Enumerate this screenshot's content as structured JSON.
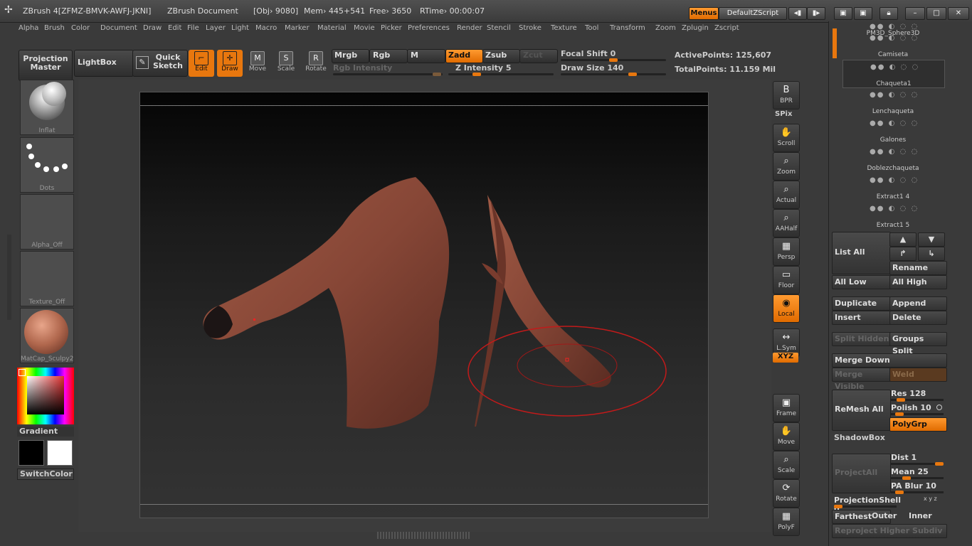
{
  "title_bar": {
    "app": "ZBrush 4[ZFMZ-BMVK-AWFJ-JKNI]",
    "document": "ZBrush Document",
    "obj": "[Obj› 9080]",
    "mem": "Mem› 445+541",
    "free": "Free› 3650",
    "rtime": "RTime› 00:00:07",
    "menus_button": "Menus",
    "script_name": "DefaultZScript"
  },
  "menu_items": [
    "Alpha",
    "Brush",
    "Color",
    "Document",
    "Draw",
    "Edit",
    "File",
    "Layer",
    "Light",
    "Macro",
    "Marker",
    "Material",
    "Movie",
    "Picker",
    "Preferences",
    "Render",
    "Stencil",
    "Stroke",
    "Texture",
    "Tool",
    "Transform",
    "Zoom",
    "Zplugin",
    "Zscript"
  ],
  "toolbar": {
    "projection_master": "Projection Master",
    "lightbox": "LightBox",
    "quick_sketch": "Quick Sketch",
    "edit": "Edit",
    "draw": "Draw",
    "move": "Move",
    "scale": "Scale",
    "rotate": "Rotate",
    "mrgb": "Mrgb",
    "rgb": "Rgb",
    "m": "M",
    "zadd": "Zadd",
    "zsub": "Zsub",
    "zcut": "Zcut",
    "rgb_intensity": "Rgb Intensity",
    "z_intensity": "Z Intensity 5",
    "focal_shift": "Focal Shift 0",
    "draw_size": "Draw Size 140",
    "active_points": "ActivePoints: 125,607",
    "total_points": "TotalPoints: 11.159 Mil",
    "z_intensity_level": 0.05,
    "draw_size_level": 0.14,
    "focal_shift_level": 0.5
  },
  "left_tray": {
    "brush_label": "Inflat",
    "stroke_label": "Dots",
    "alpha_label": "Alpha_Off",
    "texture_label": "Texture_Off",
    "material_label": "MatCap_Sculpy2",
    "gradient_label": "Gradient",
    "switchcolor_label": "SwitchColor",
    "material_color": "#b0674d",
    "primary_color": "#000000",
    "secondary_color": "#ffffff"
  },
  "right_shelf": [
    {
      "name": "bpr",
      "label": "BPR",
      "icon": "B"
    },
    {
      "name": "spix",
      "label": "SPix",
      "icon": ""
    },
    {
      "name": "scroll",
      "label": "Scroll",
      "icon": "✋"
    },
    {
      "name": "zoom",
      "label": "Zoom",
      "icon": "⌕"
    },
    {
      "name": "actual",
      "label": "Actual",
      "icon": "⌕"
    },
    {
      "name": "aahalf",
      "label": "AAHalf",
      "icon": "⌕"
    },
    {
      "name": "persp",
      "label": "Persp",
      "icon": "▦"
    },
    {
      "name": "floor",
      "label": "Floor",
      "icon": "▭"
    },
    {
      "name": "local",
      "label": "Local",
      "icon": "◉"
    },
    {
      "name": "lsym",
      "label": "L.Sym",
      "icon": "↔"
    },
    {
      "name": "xyz",
      "label": "XYZ",
      "icon": ""
    },
    {
      "name": "frame",
      "label": "Frame",
      "icon": "▣"
    },
    {
      "name": "move",
      "label": "Move",
      "icon": "✋"
    },
    {
      "name": "scale",
      "label": "Scale",
      "icon": "⌕"
    },
    {
      "name": "rotate",
      "label": "Rotate",
      "icon": "⟳"
    },
    {
      "name": "polyf",
      "label": "PolyF",
      "icon": "▦"
    }
  ],
  "subtools": [
    "PM3D_Sphere3D",
    "Camiseta",
    "Chaqueta1",
    "Lenchaqueta",
    "Galones",
    "Doblezchaqueta",
    "Extract1 4",
    "Extract1 5"
  ],
  "subtool_panel": {
    "list_all": "List All",
    "rename": "Rename",
    "all_low": "All Low",
    "all_high": "All High",
    "duplicate": "Duplicate",
    "append": "Append",
    "insert": "Insert",
    "delete": "Delete",
    "split_hidden": "Split Hidden",
    "groups_split": "Groups Split",
    "merge_down": "Merge Down",
    "merge_visible": "Merge Visible",
    "weld": "Weld",
    "remesh_all": "ReMesh All",
    "res": "Res 128",
    "polish": "Polish 10",
    "polygrp": "PolyGrp",
    "shadowbox": "ShadowBox",
    "project_all": "ProjectAll",
    "dist": "Dist 1",
    "mean": "Mean 25",
    "pa_blur": "PA Blur 10",
    "projection_shell": "ProjectionShell 0",
    "xyz_small": "x y z",
    "farthest": "Farthest",
    "outer": "Outer",
    "inner": "Inner",
    "reproject": "Reproject Higher Subdiv",
    "res_level": 0.128,
    "polish_level": 0.1,
    "dist_level": 1.0,
    "mean_level": 0.25,
    "pa_blur_level": 0.1,
    "projection_shell_level": 0
  }
}
